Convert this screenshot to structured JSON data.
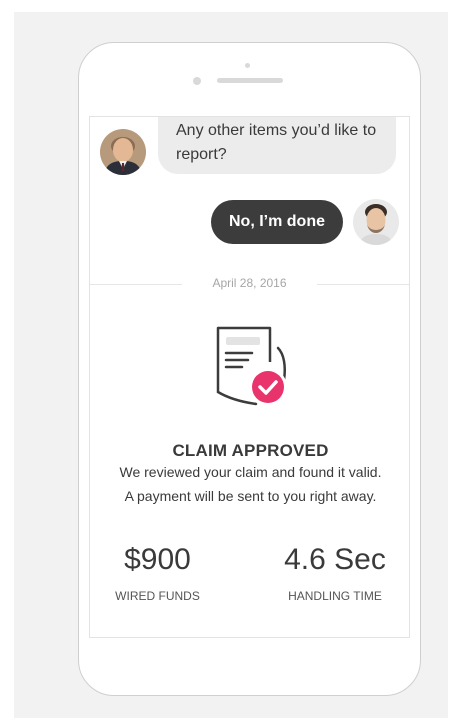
{
  "chat": {
    "agent_message": "Any other items you’d like to report?",
    "user_reply": "No, I’m done",
    "agent_avatar": "agent-avatar",
    "user_avatar": "user-avatar"
  },
  "date_divider": "April 28, 2016",
  "claim": {
    "icon": "document-check-icon",
    "title": "CLAIM APPROVED",
    "description": "We reviewed your claim and found it valid. A payment will be sent to you right away."
  },
  "stats": [
    {
      "value": "$900",
      "label": "WIRED FUNDS"
    },
    {
      "value": "4.6 Sec",
      "label": "HANDLING TIME"
    }
  ],
  "colors": {
    "accent": "#e8336d",
    "user_bubble": "#3c3c3c",
    "agent_bubble": "#ececec",
    "text": "#3a3a3a"
  }
}
